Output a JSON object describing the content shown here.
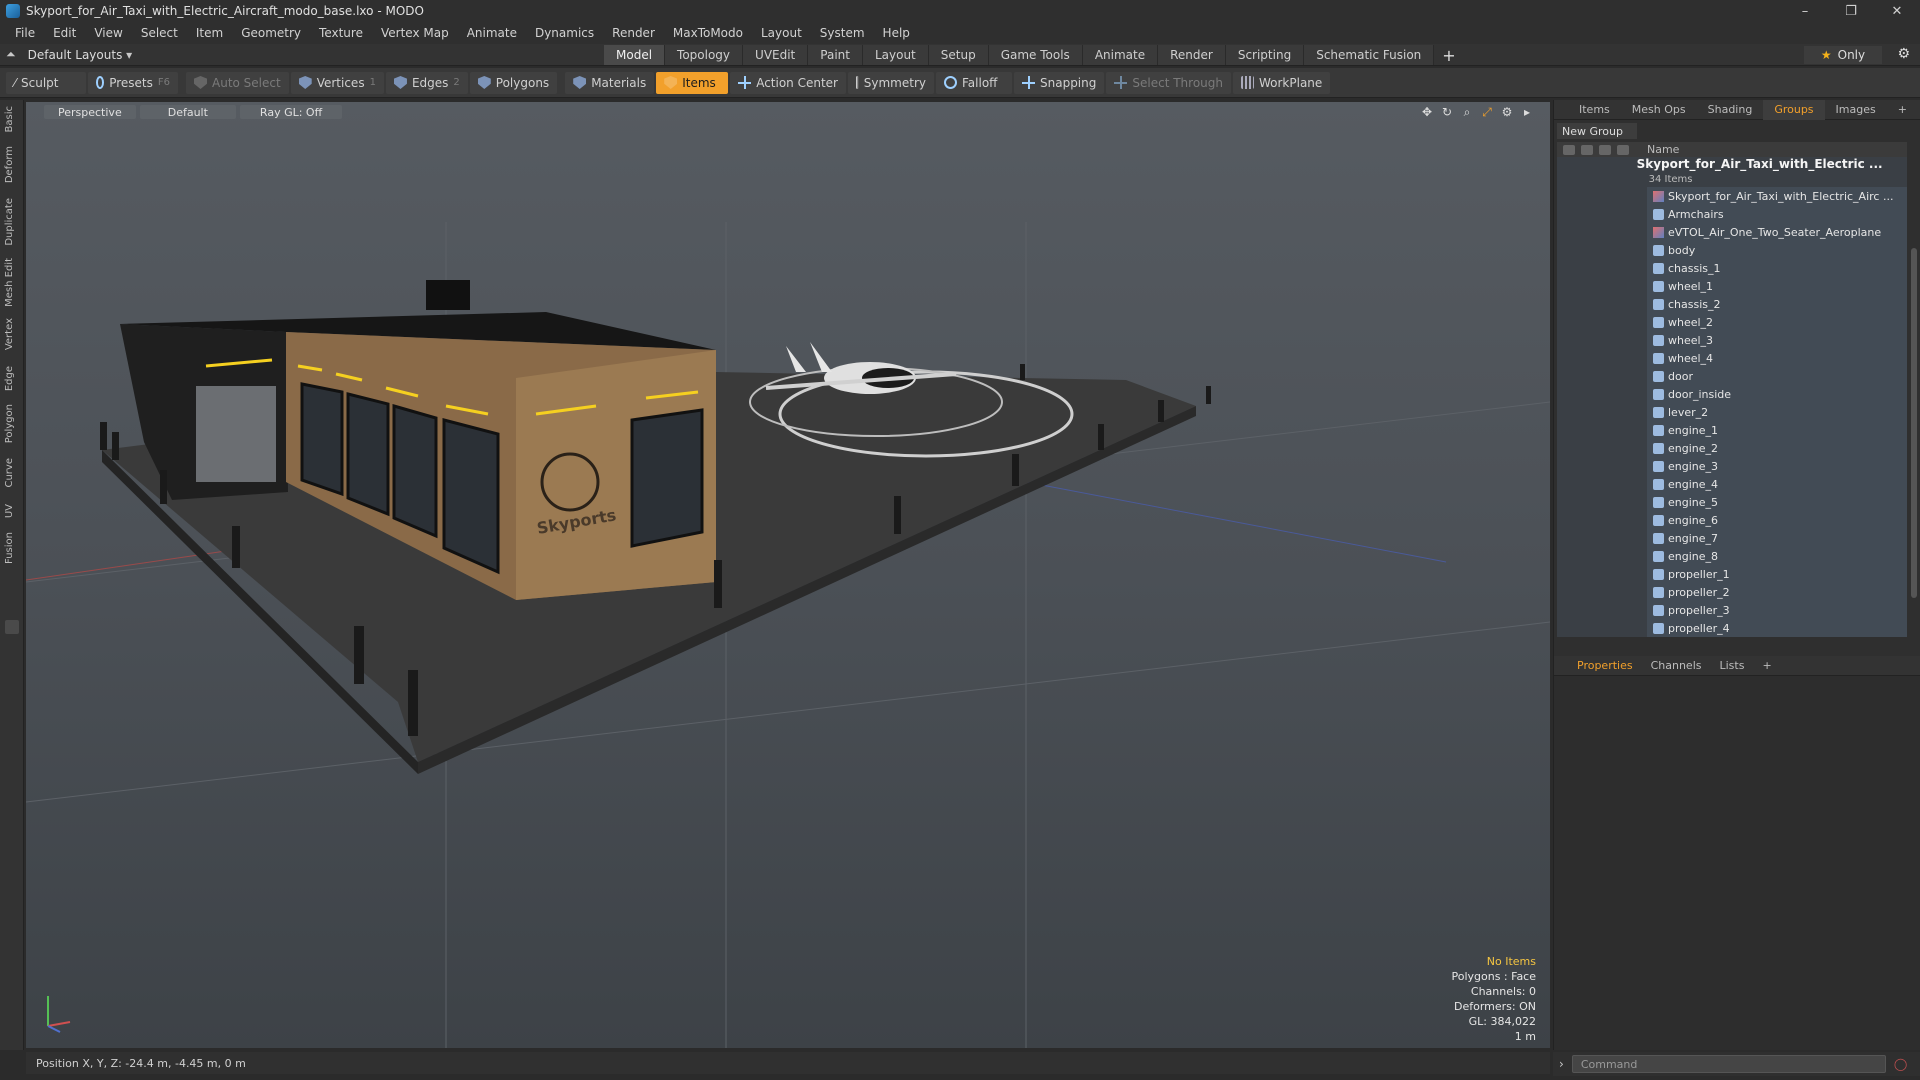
{
  "window": {
    "title": "Skyport_for_Air_Taxi_with_Electric_Aircraft_modo_base.lxo - MODO",
    "controls": [
      "–",
      "❐",
      "✕"
    ]
  },
  "menu": [
    "File",
    "Edit",
    "View",
    "Select",
    "Item",
    "Geometry",
    "Texture",
    "Vertex Map",
    "Animate",
    "Dynamics",
    "Render",
    "MaxToModo",
    "Layout",
    "System",
    "Help"
  ],
  "layout": {
    "selector": "Default Layouts",
    "tabs": [
      "Model",
      "Topology",
      "UVEdit",
      "Paint",
      "Layout",
      "Setup",
      "Game Tools",
      "Animate",
      "Render",
      "Scripting",
      "Schematic Fusion"
    ],
    "active_tab": "Model",
    "only_label": "Only"
  },
  "toolbar": {
    "sculpt": "Sculpt",
    "presets": "Presets",
    "presets_key": "F6",
    "auto_select": "Auto Select",
    "vertices": "Vertices",
    "vertices_key": "1",
    "edges": "Edges",
    "edges_key": "2",
    "polygons": "Polygons",
    "materials": "Materials",
    "items": "Items",
    "action_center": "Action Center",
    "symmetry": "Symmetry",
    "falloff": "Falloff",
    "snapping": "Snapping",
    "select_through": "Select Through",
    "workplane": "WorkPlane"
  },
  "left_strip": [
    "Basic",
    "Deform",
    "Duplicate",
    "Mesh Edit",
    "Vertex",
    "Edge",
    "Polygon",
    "Curve",
    "UV",
    "Fusion"
  ],
  "viewport": {
    "view": "Perspective",
    "shading": "Default",
    "raygl": "Ray GL: Off",
    "sign_text": "Skyports",
    "info": {
      "selection": "No Items",
      "polygons": "Polygons : Face",
      "channels": "Channels: 0",
      "deformers": "Deformers: ON",
      "gl": "GL: 384,022",
      "scale": "1 m"
    }
  },
  "status": {
    "position": "Position X, Y, Z:  -24.4 m, -4.45 m, 0 m"
  },
  "right_panel": {
    "tabs": [
      "Items",
      "Mesh Ops",
      "Shading",
      "Groups",
      "Images"
    ],
    "active_tab": "Groups",
    "new_group": "New Group",
    "col_name": "Name",
    "root": {
      "name": "Skyport_for_Air_Taxi_with_Electric ...",
      "count": "34 Items"
    },
    "items": [
      "Skyport_for_Air_Taxi_with_Electric_Airc ...",
      "Armchairs",
      "eVTOL_Air_One_Two_Seater_Aeroplane",
      "body",
      "chassis_1",
      "wheel_1",
      "chassis_2",
      "wheel_2",
      "wheel_3",
      "wheel_4",
      "door",
      "door_inside",
      "lever_2",
      "engine_1",
      "engine_2",
      "engine_3",
      "engine_4",
      "engine_5",
      "engine_6",
      "engine_7",
      "engine_8",
      "propeller_1",
      "propeller_2",
      "propeller_3",
      "propeller_4"
    ]
  },
  "props_panel": {
    "tabs": [
      "Properties",
      "Channels",
      "Lists"
    ],
    "active_tab": "Properties"
  },
  "command": {
    "placeholder": "Command"
  },
  "colors": {
    "accent": "#f2a02b",
    "viewport_bg": "#4b5056"
  }
}
